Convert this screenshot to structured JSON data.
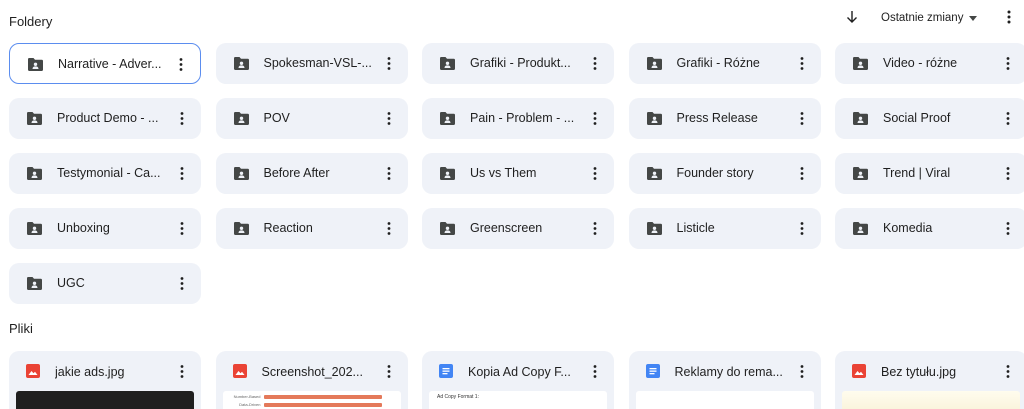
{
  "folders_section": {
    "title": "Foldery",
    "sort_label": "Ostatnie zmiany",
    "folders": [
      {
        "name": "Narrative - Adver..."
      },
      {
        "name": "Spokesman-VSL-..."
      },
      {
        "name": "Grafiki - Produkt..."
      },
      {
        "name": "Grafiki - Różne"
      },
      {
        "name": "Video - różne"
      },
      {
        "name": "Product Demo - ..."
      },
      {
        "name": "POV"
      },
      {
        "name": "Pain - Problem - ..."
      },
      {
        "name": "Press Release"
      },
      {
        "name": "Social Proof"
      },
      {
        "name": "Testymonial - Ca..."
      },
      {
        "name": "Before After"
      },
      {
        "name": "Us vs Them"
      },
      {
        "name": "Founder story"
      },
      {
        "name": "Trend | Viral"
      },
      {
        "name": "Unboxing"
      },
      {
        "name": "Reaction"
      },
      {
        "name": "Greenscreen"
      },
      {
        "name": "Listicle"
      },
      {
        "name": "Komedia"
      },
      {
        "name": "UGC"
      }
    ]
  },
  "files_section": {
    "title": "Pliki",
    "files": [
      {
        "name": "jakie ads.jpg",
        "icon": "image-icon",
        "color": "#ea4335"
      },
      {
        "name": "Screenshot_202...",
        "icon": "image-icon",
        "color": "#ea4335",
        "thumb_rows": [
          {
            "label": "Number-Based"
          },
          {
            "label": "Data-Driven"
          }
        ]
      },
      {
        "name": "Kopia Ad Copy F...",
        "icon": "docs-icon",
        "color": "#4285f4",
        "thumb_text": "Ad Copy Format 1:"
      },
      {
        "name": "Reklamy do rema...",
        "icon": "docs-icon",
        "color": "#4285f4"
      },
      {
        "name": "Bez tytułu.jpg",
        "icon": "image-icon",
        "color": "#ea4335"
      }
    ]
  }
}
